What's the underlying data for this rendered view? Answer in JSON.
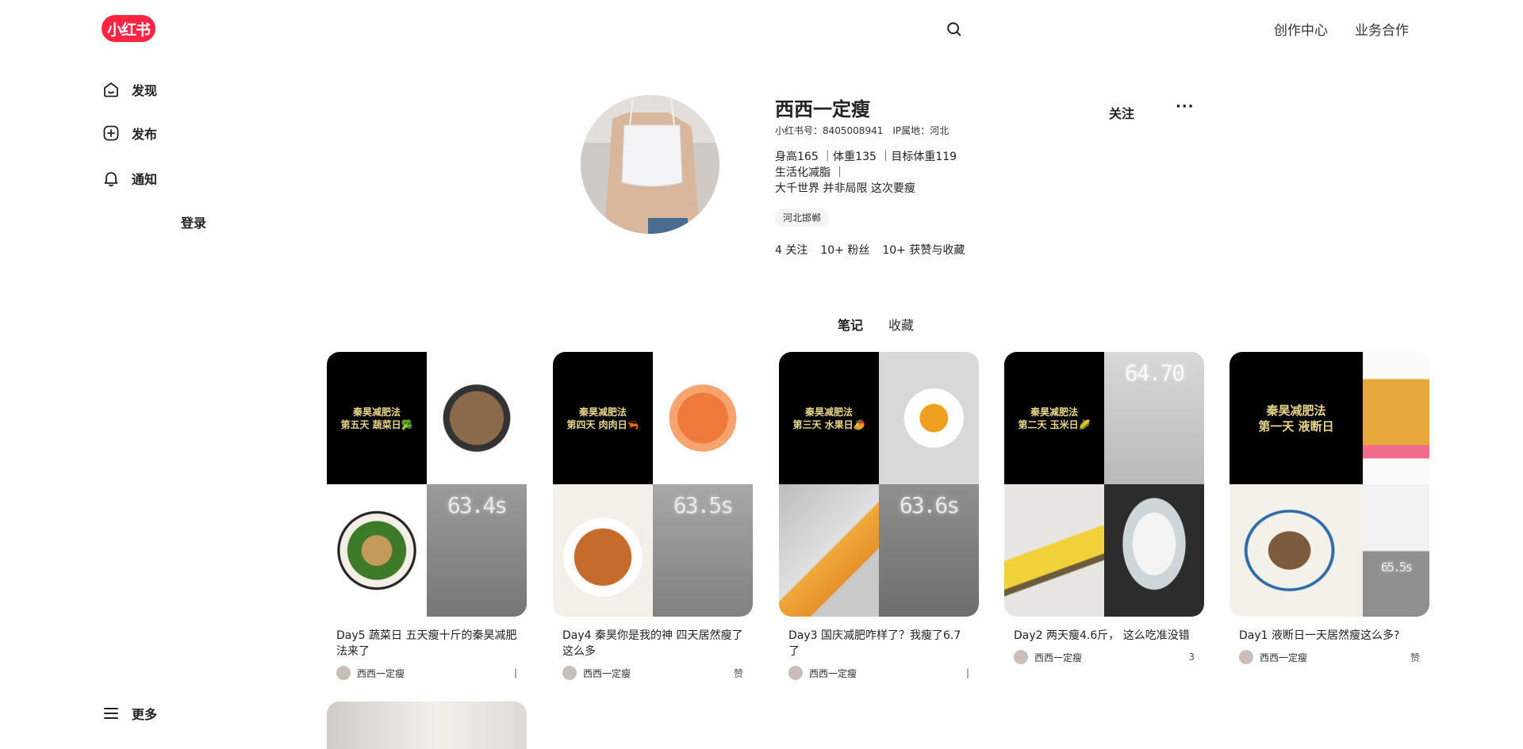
{
  "header": {
    "logo": "小红书",
    "links": [
      "创作中心",
      "业务合作"
    ]
  },
  "sidebar": {
    "items": [
      {
        "label": "发现",
        "icon": "home-icon"
      },
      {
        "label": "发布",
        "icon": "plus-icon"
      },
      {
        "label": "通知",
        "icon": "bell-icon"
      }
    ],
    "login": "登录",
    "more": "更多"
  },
  "profile": {
    "name": "西西一定瘦",
    "id_text": "小红书号：8405008941",
    "ip_text": "IP属地：河北",
    "bio_lines": [
      "身高165 ｜体重135 ｜目标体重119",
      "生活化减脂 ｜",
      "大千世界 并非局限 这次要瘦"
    ],
    "tag": "河北邯郸",
    "stats": {
      "following": "4 关注",
      "fans": "10+ 粉丝",
      "likes": "10+ 获赞与收藏"
    },
    "follow_label": "关注",
    "more_label": "···"
  },
  "tabs": [
    {
      "label": "笔记",
      "active": true
    },
    {
      "label": "收藏",
      "active": false
    }
  ],
  "notes": [
    {
      "title": "Day5 蔬菜日 五天瘦十斤的秦昊减肥法来了",
      "author": "西西一定瘦",
      "caption": [
        "秦昊减肥法",
        "第五天 蔬菜日🥦"
      ],
      "scale": "63.4s",
      "likes": "|"
    },
    {
      "title": "Day4 秦昊你是我的神 四天居然瘦了这么多",
      "author": "西西一定瘦",
      "caption": [
        "秦昊减肥法",
        "第四天 肉肉日🦐"
      ],
      "scale": "63.5s",
      "likes": "赞"
    },
    {
      "title": "Day3 国庆减肥咋样了？我瘦了6.7了",
      "author": "西西一定瘦",
      "caption": [
        "秦昊减肥法",
        "第三天 水果日🥭"
      ],
      "scale": "63.6s",
      "likes": "|"
    },
    {
      "title": "Day2 两天瘦4.6斤，  这么吃准没错",
      "author": "西西一定瘦",
      "caption": [
        "秦昊减肥法",
        "第二天 玉米日🌽"
      ],
      "scale": "64.70",
      "likes": "3"
    },
    {
      "title": "Day1 液断日一天居然瘦这么多?",
      "author": "西西一定瘦",
      "caption": [
        "秦昊减肥法",
        "第一天 液断日"
      ],
      "scale": "65.5s",
      "likes": "赞"
    }
  ],
  "colors": {
    "brand": "#ff2442"
  }
}
